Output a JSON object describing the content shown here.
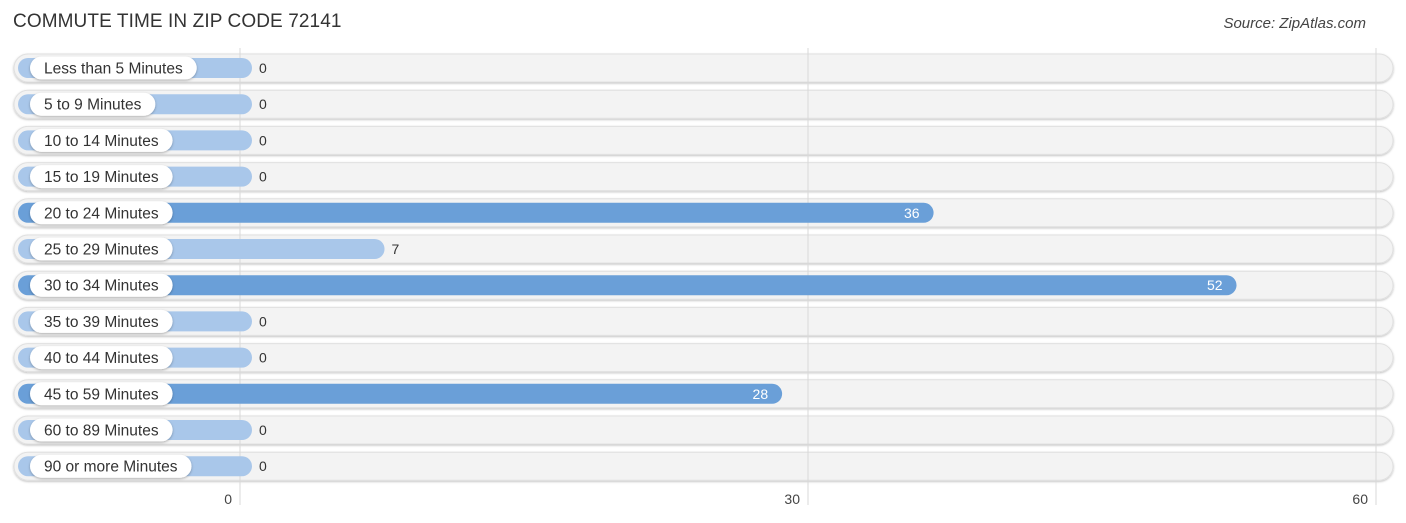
{
  "header": {
    "title": "COMMUTE TIME IN ZIP CODE 72141",
    "source": "Source: ZipAtlas.com"
  },
  "colors": {
    "bar_strong": "#6a9fd8",
    "bar_light": "#a9c7ea",
    "track": "#f3f3f3",
    "grid": "#d8d8d8"
  },
  "chart_data": {
    "type": "bar",
    "orientation": "horizontal",
    "title": "COMMUTE TIME IN ZIP CODE 72141",
    "source": "Source: ZipAtlas.com",
    "xlabel": "",
    "ylabel": "",
    "categories": [
      "Less than 5 Minutes",
      "5 to 9 Minutes",
      "10 to 14 Minutes",
      "15 to 19 Minutes",
      "20 to 24 Minutes",
      "25 to 29 Minutes",
      "30 to 34 Minutes",
      "35 to 39 Minutes",
      "40 to 44 Minutes",
      "45 to 59 Minutes",
      "60 to 89 Minutes",
      "90 or more Minutes"
    ],
    "values": [
      0,
      0,
      0,
      0,
      36,
      7,
      52,
      0,
      0,
      28,
      0,
      0
    ],
    "value_labels": [
      "0",
      "0",
      "0",
      "0",
      "36",
      "7",
      "52",
      "0",
      "0",
      "28",
      "0",
      "0"
    ],
    "xlim": [
      0,
      60
    ],
    "xticks": [
      0,
      30,
      60
    ],
    "xtick_labels": [
      "0",
      "30",
      "60"
    ],
    "grid": true,
    "legend": "none"
  }
}
